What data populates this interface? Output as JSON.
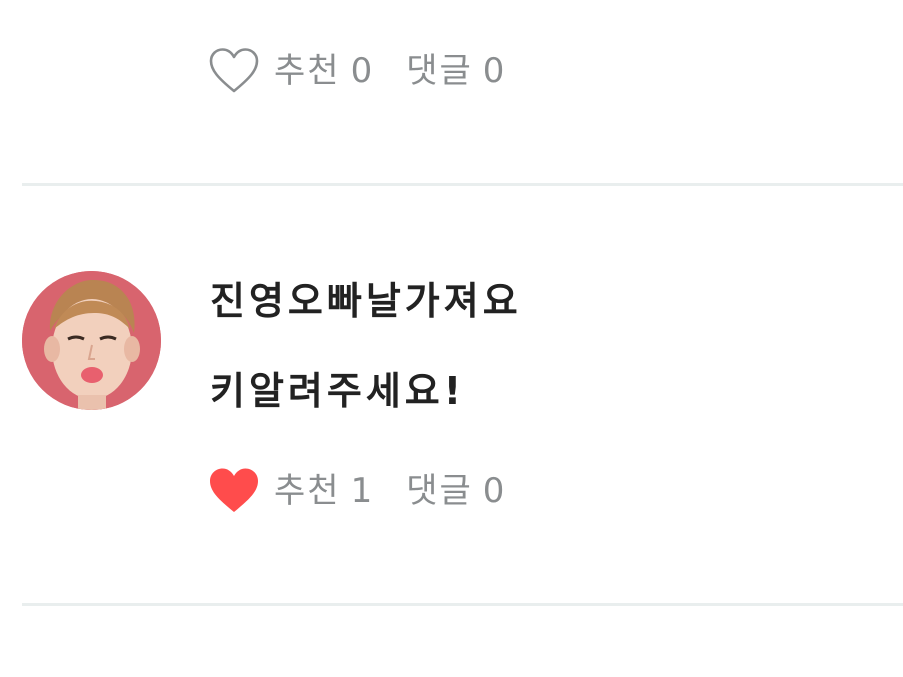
{
  "posts": [
    {
      "liked": false,
      "like_label": "추천",
      "like_count": "0",
      "comment_label": "댓글",
      "comment_count": "0"
    },
    {
      "liked": true,
      "lines": [
        "진영오빠날가져요",
        "키알려주세요!"
      ],
      "like_label": "추천",
      "like_count": "1",
      "comment_label": "댓글",
      "comment_count": "0"
    }
  ],
  "colors": {
    "heart_active": "#ff4c4c",
    "heart_inactive_stroke": "#8a8d8f",
    "meta_text": "#8a8d8f",
    "divider": "#e9eeee",
    "body_text": "#222222"
  },
  "icons": {
    "like_icon_outline": "heart-outline-icon",
    "like_icon_filled": "heart-filled-icon"
  }
}
